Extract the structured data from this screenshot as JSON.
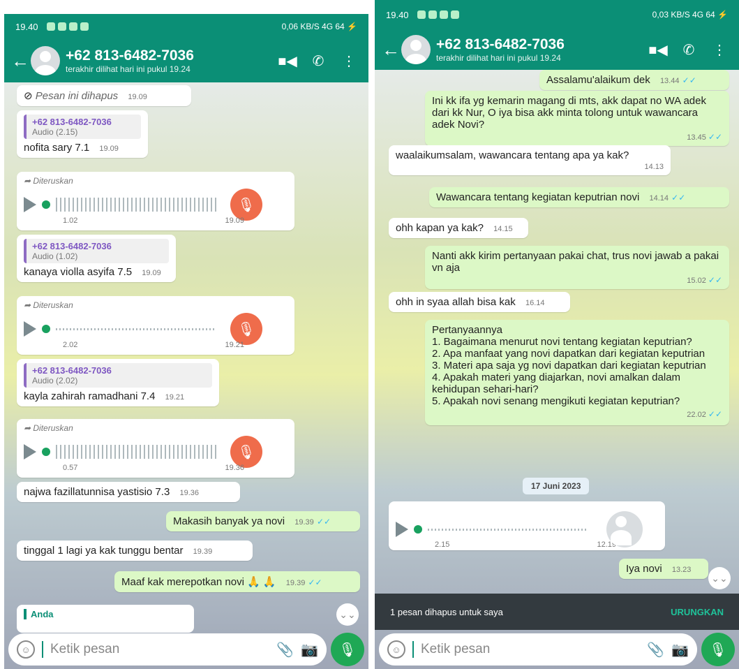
{
  "left": {
    "status": {
      "time": "19.40",
      "right": "0,06 KB/S 4G 64 ⚡"
    },
    "header": {
      "name": "+62 813-6482-7036",
      "status": "terakhir dilihat hari ini pukul 19.24"
    },
    "messages": {
      "deleted": {
        "text": "Pesan ini dihapus",
        "time": "19.09"
      },
      "m1": {
        "quote_name": "+62 813-6482-7036",
        "quote_sub": "Audio (2.15)",
        "text": "nofita sary 7.1",
        "time": "19.09"
      },
      "v1": {
        "label": "Diteruskan",
        "duration": "1.02",
        "time": "19.09"
      },
      "m2": {
        "quote_name": "+62 813-6482-7036",
        "quote_sub": "Audio (1.02)",
        "text": "kanaya violla asyifa 7.5",
        "time": "19.09"
      },
      "v2": {
        "label": "Diteruskan",
        "duration": "2.02",
        "time": "19.21"
      },
      "m3": {
        "quote_name": "+62 813-6482-7036",
        "quote_sub": "Audio (2.02)",
        "text": "kayla zahirah ramadhani 7.4",
        "time": "19.21"
      },
      "v3": {
        "label": "Diteruskan",
        "duration": "0.57",
        "time": "19.36"
      },
      "m4": {
        "text": "najwa fazillatunnisa yastisio 7.3",
        "time": "19.36"
      },
      "m5": {
        "text": "Makasih banyak ya novi",
        "time": "19.39"
      },
      "m6": {
        "text": "tinggal 1 lagi ya kak tunggu bentar",
        "time": "19.39"
      },
      "m7": {
        "text": "Maaf kak merepotkan novi 🙏 🙏",
        "time": "19.39"
      },
      "reply_name": "Anda"
    },
    "composer": {
      "placeholder": "Ketik pesan"
    }
  },
  "right": {
    "status": {
      "time": "19.40",
      "right": "0,03 KB/S 4G 64 ⚡"
    },
    "header": {
      "name": "+62 813-6482-7036",
      "status": "terakhir dilihat hari ini pukul 19.24"
    },
    "messages": {
      "r1": {
        "text": "Assalamu'alaikum dek",
        "time": "13.44"
      },
      "r2": {
        "text": "Ini kk ifa yg kemarin magang di mts, akk dapat no WA adek dari kk Nur, O iya bisa akk minta tolong untuk wawancara adek Novi?",
        "time": "13.45"
      },
      "r3": {
        "text": "waalaikumsalam, wawancara tentang apa ya kak?",
        "time": "14.13"
      },
      "r4": {
        "text": "Wawancara tentang kegiatan keputrian novi",
        "time": "14.14"
      },
      "r5": {
        "text": "ohh kapan ya kak?",
        "time": "14.15"
      },
      "r6": {
        "text": "Nanti akk kirim pertanyaan pakai chat, trus novi jawab a pakai vn aja",
        "time": "15.02"
      },
      "r7": {
        "text": "ohh in syaa allah bisa kak",
        "time": "16.14"
      },
      "r8": {
        "lines": [
          "Pertanyaannya",
          "1. Bagaimana menurut novi tentang kegiatan keputrian?",
          "2. Apa manfaat yang novi dapatkan dari kegiatan keputrian",
          "3. Materi apa saja yg novi dapatkan dari kegiatan keputrian",
          "4. Apakah materi yang diajarkan, novi amalkan dalam kehidupan sehari-hari?",
          "5. Apakah novi senang mengikuti kegiatan keputrian?"
        ],
        "time": "22.02"
      },
      "date": "17 Juni 2023",
      "v1": {
        "duration": "2.15",
        "time": "12.19"
      },
      "r9": {
        "text": "Iya novi",
        "time": "13.23"
      }
    },
    "snackbar": {
      "text": "1 pesan dihapus untuk saya",
      "action": "URUNGKAN"
    },
    "composer": {
      "placeholder": "Ketik pesan"
    }
  },
  "colors": {
    "header": "#0b8f76",
    "outgoing": "#dcf8c6",
    "incoming": "#ffffff",
    "mic_orange": "#ef6c4b",
    "mic_green": "#1fa855"
  }
}
